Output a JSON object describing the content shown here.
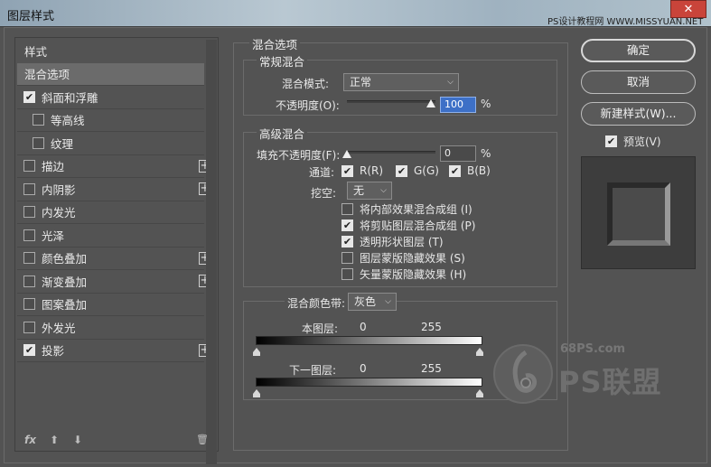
{
  "window": {
    "title": "图层样式",
    "watermark": "PS设计教程网 WWW.MISSYUAN.NET",
    "close_glyph": "✕"
  },
  "left_panel": {
    "header": "样式",
    "items": [
      {
        "label": "混合选项",
        "checkbox": false,
        "checked": false,
        "plus": false,
        "selected": true,
        "indent": 0
      },
      {
        "label": "斜面和浮雕",
        "checkbox": true,
        "checked": true,
        "plus": false,
        "selected": false,
        "indent": 0
      },
      {
        "label": "等高线",
        "checkbox": true,
        "checked": false,
        "plus": false,
        "selected": false,
        "indent": 1
      },
      {
        "label": "纹理",
        "checkbox": true,
        "checked": false,
        "plus": false,
        "selected": false,
        "indent": 1
      },
      {
        "label": "描边",
        "checkbox": true,
        "checked": false,
        "plus": true,
        "selected": false,
        "indent": 0
      },
      {
        "label": "内阴影",
        "checkbox": true,
        "checked": false,
        "plus": true,
        "selected": false,
        "indent": 0
      },
      {
        "label": "内发光",
        "checkbox": true,
        "checked": false,
        "plus": false,
        "selected": false,
        "indent": 0
      },
      {
        "label": "光泽",
        "checkbox": true,
        "checked": false,
        "plus": false,
        "selected": false,
        "indent": 0
      },
      {
        "label": "颜色叠加",
        "checkbox": true,
        "checked": false,
        "plus": true,
        "selected": false,
        "indent": 0
      },
      {
        "label": "渐变叠加",
        "checkbox": true,
        "checked": false,
        "plus": true,
        "selected": false,
        "indent": 0
      },
      {
        "label": "图案叠加",
        "checkbox": true,
        "checked": false,
        "plus": false,
        "selected": false,
        "indent": 0
      },
      {
        "label": "外发光",
        "checkbox": true,
        "checked": false,
        "plus": false,
        "selected": false,
        "indent": 0
      },
      {
        "label": "投影",
        "checkbox": true,
        "checked": true,
        "plus": true,
        "selected": false,
        "indent": 0
      }
    ],
    "fx_label": "fx",
    "up_glyph": "⬆",
    "down_glyph": "⬇",
    "trash_glyph": "🗑"
  },
  "blend_options": {
    "title": "混合选项",
    "general": {
      "title": "常规混合",
      "mode_label": "混合模式:",
      "mode_value": "正常",
      "opacity_label": "不透明度(O):",
      "opacity_value": "100",
      "opacity_fraction": 1.0,
      "percent": "%"
    },
    "advanced": {
      "title": "高级混合",
      "fill_label": "填充不透明度(F):",
      "fill_value": "0",
      "fill_fraction": 0.0,
      "percent": "%",
      "channels_label": "通道:",
      "channels": [
        {
          "label": "R(R)",
          "checked": true
        },
        {
          "label": "G(G)",
          "checked": true
        },
        {
          "label": "B(B)",
          "checked": true
        }
      ],
      "knockout_label": "挖空:",
      "knockout_value": "无",
      "options": [
        {
          "label": "将内部效果混合成组 (I)",
          "checked": false
        },
        {
          "label": "将剪贴图层混合成组 (P)",
          "checked": true
        },
        {
          "label": "透明形状图层 (T)",
          "checked": true
        },
        {
          "label": "图层蒙版隐藏效果 (S)",
          "checked": false
        },
        {
          "label": "矢量蒙版隐藏效果 (H)",
          "checked": false
        }
      ]
    },
    "blend_if": {
      "label": "混合颜色带:",
      "value": "灰色",
      "this_layer_label": "本图层:",
      "this_layer_min": "0",
      "this_layer_max": "255",
      "underlying_label": "下一图层:",
      "underlying_min": "0",
      "underlying_max": "255"
    }
  },
  "buttons": {
    "ok": "确定",
    "cancel": "取消",
    "new_style": "新建样式(W)...",
    "preview_label": "预览(V)",
    "preview_checked": true
  },
  "branding": {
    "site": "68PS.com",
    "brand": "PS联盟"
  },
  "colors": {
    "panel_bg": "#535353",
    "selected_bg": "#6b6b6b",
    "active_input": "#3d70c7",
    "close_button": "#c9443a"
  }
}
